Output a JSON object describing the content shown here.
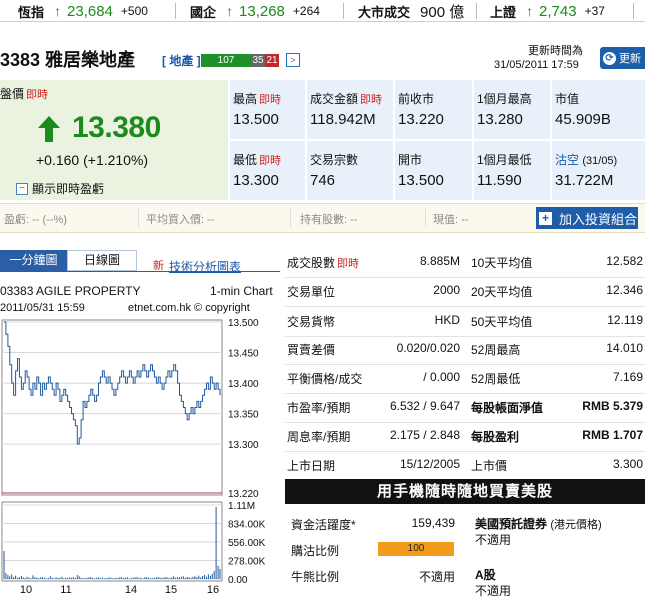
{
  "ticker": [
    {
      "name": "恆指",
      "value": "23,684",
      "change": "+500"
    },
    {
      "name": "國企",
      "value": "13,268",
      "change": "+264"
    },
    {
      "name": "大市成交",
      "value": "900 億"
    },
    {
      "name": "上證",
      "value": "2,743",
      "change": "+37"
    }
  ],
  "stock": {
    "title": "3383 雅居樂地產",
    "sector": "[ 地產 ]",
    "sector_up": "107",
    "sector_unch": "35",
    "sector_down": "21",
    "sector_next": ">",
    "update_label": "更新時間為",
    "update_time": "31/05/2011 17:59",
    "refresh_label": "更新"
  },
  "quote": {
    "label": "盤價",
    "realtime_tag": "即時",
    "price": "13.380",
    "change": "+0.160 (+1.210%)",
    "pe_toggle": "顯示即時盈虧",
    "pe_toggle_icon": "[-]",
    "direction": "up",
    "up_color": "#1d8a1d",
    "cells": [
      {
        "label": "最高",
        "realtime": "即時",
        "value": "13.500"
      },
      {
        "label": "成交金額",
        "realtime": "即時",
        "value": "118.942M"
      },
      {
        "label": "前收市",
        "value": "13.220"
      },
      {
        "label": "1個月最高",
        "value": "13.280"
      },
      {
        "label": "市值",
        "value": "45.909B"
      },
      {
        "label": "最低",
        "realtime": "即時",
        "value": "13.300"
      },
      {
        "label": "交易宗數",
        "value": "746"
      },
      {
        "label": "開市",
        "value": "13.500"
      },
      {
        "label": "1個月最低",
        "value": "11.590"
      },
      {
        "label": "沽空",
        "sub": "(31/05)",
        "value": "31.722M"
      }
    ]
  },
  "portfolio": {
    "pnl": "盈虧: -- (--%)",
    "avg_buy": "平均買入價: --",
    "shares": "持有股數: --",
    "current": "現值: --",
    "add_button": "加入投資組合",
    "add_icon": "+"
  },
  "chart_tabs": {
    "minute": "一分鐘圖",
    "daily": "日線圖",
    "new_tag": "新",
    "ta_link": "技術分析圖表"
  },
  "chart_data": {
    "type": "line",
    "name": "03383 AGILE PROPERTY",
    "chart_type_label": "1-min Chart",
    "datetime": "2011/05/31 15:59",
    "source": "etnet.com.hk © copyright",
    "price_ticks": [
      "13.500",
      "13.450",
      "13.400",
      "13.350",
      "13.300",
      "13.220"
    ],
    "prev_close": 13.22,
    "ylim": [
      13.22,
      13.5
    ],
    "volume_ticks": [
      "1.11M",
      "834.00K",
      "556.00K",
      "278.00K",
      "0.00"
    ],
    "volume_ylim": [
      0,
      1110000
    ],
    "x_ticks": [
      "10",
      "11",
      "14",
      "15",
      "16"
    ],
    "prices": [
      13.5,
      13.48,
      13.46,
      13.43,
      13.4,
      13.38,
      13.42,
      13.44,
      13.41,
      13.39,
      13.4,
      13.42,
      13.41,
      13.39,
      13.38,
      13.4,
      13.39,
      13.41,
      13.4,
      13.38,
      13.4,
      13.39,
      13.4,
      13.41,
      13.4,
      13.39,
      13.38,
      13.4,
      13.39,
      13.37,
      13.38,
      13.39,
      13.38,
      13.37,
      13.36,
      13.35,
      13.34,
      13.33,
      13.3,
      13.31,
      13.34,
      13.37,
      13.36,
      13.37,
      13.38,
      13.39,
      13.38,
      13.37,
      13.38,
      13.4,
      13.41,
      13.42,
      13.41,
      13.4,
      13.41,
      13.4,
      13.39,
      13.38,
      13.39,
      13.4,
      13.41,
      13.42,
      13.41,
      13.4,
      13.41,
      13.42,
      13.41,
      13.4,
      13.41,
      13.42,
      13.41,
      13.42,
      13.43,
      13.42,
      13.41,
      13.42,
      13.43,
      13.42,
      13.41,
      13.4,
      13.41,
      13.4,
      13.39,
      13.4,
      13.41,
      13.42,
      13.41,
      13.42,
      13.43,
      13.42,
      13.4,
      13.38,
      13.37,
      13.36,
      13.35,
      13.34,
      13.35,
      13.36,
      13.35,
      13.36,
      13.37,
      13.36,
      13.37,
      13.38,
      13.39,
      13.4,
      13.39,
      13.41,
      13.4,
      13.39,
      13.4,
      13.39,
      13.38
    ],
    "volumes": [
      420000,
      90000,
      60000,
      40000,
      70000,
      30000,
      50000,
      20000,
      30000,
      45000,
      25000,
      15000,
      35000,
      20000,
      10000,
      55000,
      30000,
      20000,
      15000,
      25000,
      30000,
      20000,
      10000,
      15000,
      40000,
      20000,
      10000,
      25000,
      15000,
      20000,
      35000,
      10000,
      20000,
      15000,
      25000,
      20000,
      30000,
      15000,
      60000,
      40000,
      20000,
      15000,
      10000,
      20000,
      25000,
      30000,
      15000,
      10000,
      20000,
      25000,
      15000,
      20000,
      10000,
      15000,
      20000,
      25000,
      15000,
      10000,
      20000,
      15000,
      25000,
      30000,
      15000,
      20000,
      25000,
      10000,
      15000,
      20000,
      25000,
      30000,
      15000,
      20000,
      10000,
      25000,
      30000,
      20000,
      15000,
      10000,
      20000,
      25000,
      30000,
      20000,
      15000,
      25000,
      30000,
      20000,
      15000,
      25000,
      40000,
      20000,
      30000,
      25000,
      35000,
      40000,
      20000,
      30000,
      25000,
      20000,
      35000,
      40000,
      30000,
      50000,
      25000,
      45000,
      60000,
      35000,
      70000,
      50000,
      80000,
      120000,
      1080000,
      200000,
      150000
    ]
  },
  "stats": {
    "rows": [
      {
        "l1": "成交股數",
        "rt": "即時",
        "v1": "8.885M",
        "l2": "10天平均值",
        "v2": "12.582"
      },
      {
        "l1": "交易單位",
        "v1": "2000",
        "l2": "20天平均值",
        "v2": "12.346"
      },
      {
        "l1": "交易貨幣",
        "v1": "HKD",
        "l2": "50天平均值",
        "v2": "12.119"
      },
      {
        "l1": "買賣差價",
        "v1": "0.020/0.020",
        "l2": "52周最高",
        "v2": "14.010"
      },
      {
        "l1": "平衡價格/成交",
        "v1": "/ 0.000",
        "l2": "52周最低",
        "v2": "7.169"
      },
      {
        "l1": "市盈率/預期",
        "v1": "6.532 / 9.647",
        "l2": "每股帳面淨值",
        "v2": "RMB 5.379",
        "bold2": true
      },
      {
        "l1": "周息率/預期",
        "v1": "2.175 / 2.848",
        "l2": "每股盈利",
        "v2": "RMB 1.707",
        "bold2": true
      },
      {
        "l1": "上市日期",
        "v1": "15/12/2005",
        "l2": "上市價",
        "v2": "3.300"
      }
    ],
    "promo": "用手機隨時隨地買賣美股",
    "fund_activity_label": "資金活躍度*",
    "fund_activity_value": "159,439",
    "buy_ratio_label": "購沽比例",
    "buy_ratio_value": "100",
    "bull_bear_label": "牛熊比例",
    "bull_bear_value": "不適用",
    "us_depository_label": "美國預託證券",
    "us_depository_note": "(港元價格)",
    "us_depository_value": "不適用",
    "a_share_label": "A股",
    "a_share_value": "不適用"
  }
}
